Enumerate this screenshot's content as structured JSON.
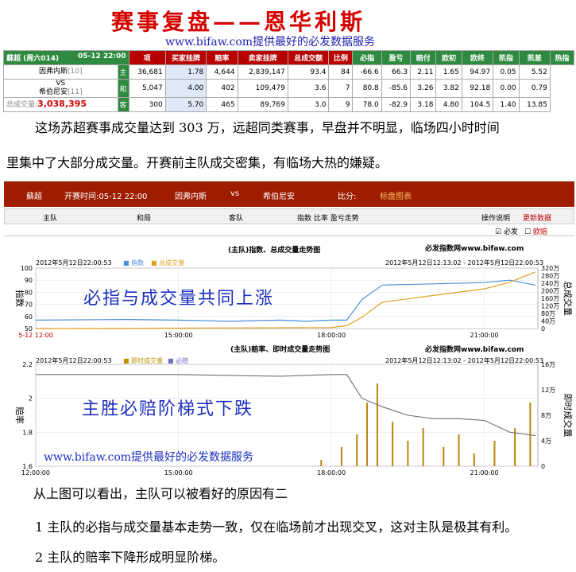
{
  "header": {
    "title": "赛事复盘——恩华利斯",
    "subtitle": "www.bifaw.com提供最好的必发数据服务"
  },
  "odds_table": {
    "match_label": "蘇超 (周六014)",
    "match_time": "05-12 22:00",
    "columns": [
      "项",
      "买家挂牌",
      "赔率",
      "卖家挂牌",
      "总成交额",
      "比例",
      "必指",
      "盈亏",
      "赔付",
      "欧初",
      "欧终",
      "凯指",
      "凯差",
      "热指"
    ],
    "home_team": "因弗内斯",
    "home_rank": "[10]",
    "vs": "VS",
    "away_team": "希伯尼安",
    "away_rank": "[11]",
    "total_label": "总成交量:",
    "total_value": "3,038,395",
    "rows": [
      {
        "side": "主",
        "cells": [
          "36,681",
          "1.78",
          "4,644",
          "2,839,147",
          "93.4",
          "84",
          "-66.6",
          "66.3",
          "2.11",
          "1.65",
          "94.97",
          "0.05",
          "5.52"
        ]
      },
      {
        "side": "和",
        "cells": [
          "5,047",
          "4.00",
          "402",
          "109,479",
          "3.6",
          "7",
          "80.8",
          "-85.6",
          "3.26",
          "3.82",
          "92.18",
          "0.00",
          "0.79"
        ]
      },
      {
        "side": "客",
        "cells": [
          "300",
          "5.70",
          "465",
          "89,769",
          "3.0",
          "9",
          "78.0",
          "-82.9",
          "3.18",
          "4.80",
          "104.5",
          "1.40",
          "13.85"
        ]
      }
    ]
  },
  "paragraph1_line1": "这场苏超赛事成交量达到 303 万，远超同类赛事，早盘并不明显，临场四小时时间",
  "paragraph1_line2": "里集中了大部分成交量。开赛前主队成交密集，有临场大热的嫌疑。",
  "match_bar": {
    "league": "蘇超",
    "kickoff": "开赛时间:05-12 22:00",
    "home": "因弗内斯",
    "vs": "vs",
    "away": "希伯尼安",
    "score": "比分:",
    "link": "标盘图表"
  },
  "tabs": {
    "home": "主队",
    "draw": "和局",
    "away": "客队",
    "metrics": "指数 比率 盈亏走势",
    "help": "操作说明",
    "refresh": "更新数据"
  },
  "checks": {
    "bifa": "必发",
    "bookmaker": "欧赔"
  },
  "chart1": {
    "title": "(主队)指数、总成交量走势图",
    "brand": "必发指数网www.bifaw.com",
    "timestamp": "2012年5月12日22:00:53",
    "legend1": "指数",
    "legend2": "总成交量",
    "range": "2012年5月12日12:13:02 - 2012年5月12日22:00:53",
    "ylabel_left": "指数",
    "ylabel_right": "总成交量",
    "overlay": "必指与成交量共同上涨",
    "y_left": [
      "100",
      "90",
      "80",
      "70",
      "60",
      "50"
    ],
    "y_right": [
      "320万",
      "280万",
      "240万",
      "200万",
      "160万",
      "120万",
      "80万",
      "40万",
      "0"
    ],
    "x_ticks": [
      "5-12 12:00",
      "15:00:00",
      "18:00:00",
      "21:00:00"
    ]
  },
  "chart2": {
    "title": "(主队)赔率、即时成交量走势图",
    "brand": "必发指数网www.bifaw.com",
    "timestamp": "2012年5月12日22:00:53",
    "legend1": "即时成交量",
    "legend2": "必赔",
    "range": "2012年5月12日12:13:02 - 2012年5月12日22:00:53",
    "ylabel_left": "赔率",
    "ylabel_right": "即时成交量",
    "overlay": "主胜必赔阶梯式下跌",
    "watermark": "www.bifaw.com提供最好的必发数据服务",
    "y_left": [
      "2.2",
      "2",
      "1.8",
      "1.6"
    ],
    "y_right": [
      "16万",
      "12万",
      "8万",
      "4万",
      "0"
    ],
    "x_ticks": [
      "12:00:00",
      "15:00:00",
      "18:00:00",
      "21:00:00"
    ]
  },
  "paragraph2": "从上图可以看出，主队可以被看好的原因有二",
  "paragraph3": "1 主队的必指与成交量基本走势一致，仅在临场前才出现交叉，这对主队是极其有利。",
  "paragraph4": "2 主队的赔率下降形成明显阶梯。",
  "chart_data": [
    {
      "type": "line",
      "title": "(主队)指数、总成交量走势图",
      "xlabel": "",
      "ylabel": "指数",
      "ylabel_right": "总成交量",
      "x_ticks": [
        "5-12 12:00",
        "15:00:00",
        "18:00:00",
        "21:00:00"
      ],
      "ylim": [
        50,
        100
      ],
      "ylim_right": [
        0,
        320
      ],
      "series": [
        {
          "name": "指数",
          "x": [
            12.2,
            14,
            15,
            16,
            17,
            17.5,
            18,
            18.3,
            18.6,
            19,
            20,
            21,
            21.5,
            22
          ],
          "values": [
            57,
            57.5,
            57,
            56,
            57,
            56,
            57,
            57,
            74,
            86,
            87,
            88,
            90,
            86
          ]
        },
        {
          "name": "总成交量",
          "x": [
            12.2,
            15,
            18,
            18.3,
            18.6,
            19,
            20,
            21,
            21.5,
            22
          ],
          "values": [
            0,
            2,
            5,
            15,
            60,
            140,
            175,
            210,
            245,
            300
          ]
        }
      ]
    },
    {
      "type": "line",
      "title": "(主队)赔率、即时成交量走势图",
      "xlabel": "",
      "ylabel": "赔率",
      "ylabel_right": "即时成交量",
      "x_ticks": [
        "12:00:00",
        "15:00:00",
        "18:00:00",
        "21:00:00"
      ],
      "ylim": [
        1.6,
        2.2
      ],
      "ylim_right": [
        0,
        16
      ],
      "series": [
        {
          "name": "必赔",
          "x": [
            12.2,
            15,
            17,
            18,
            18.3,
            18.6,
            19,
            19.5,
            20,
            20.5,
            21,
            21.5,
            22
          ],
          "values": [
            2.14,
            2.14,
            2.13,
            2.14,
            2.14,
            2.0,
            1.95,
            1.9,
            1.88,
            1.88,
            1.87,
            1.8,
            1.78
          ]
        },
        {
          "name": "即时成交量",
          "x": [
            17.8,
            18.2,
            18.5,
            18.7,
            18.9,
            19.2,
            19.5,
            19.8,
            20.2,
            20.5,
            20.8,
            21.2,
            21.6,
            21.9
          ],
          "values": [
            1,
            3,
            5,
            10,
            13,
            7,
            4,
            6,
            3,
            5,
            2,
            4,
            6,
            10
          ]
        }
      ]
    }
  ]
}
